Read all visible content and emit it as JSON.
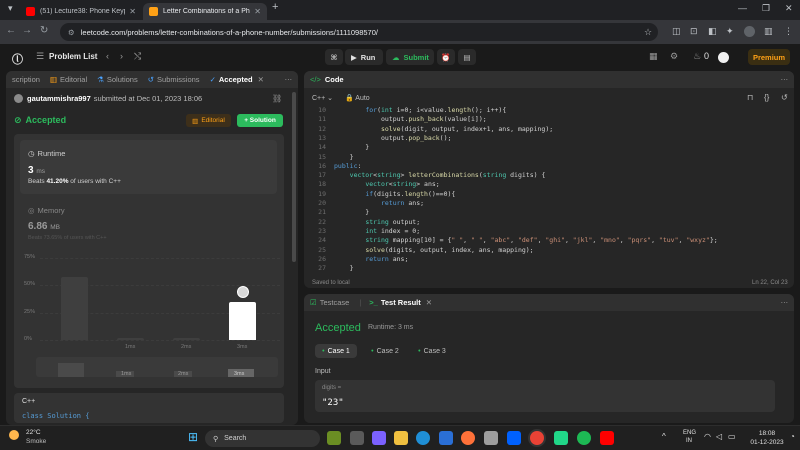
{
  "browser": {
    "tabs": [
      {
        "title": "(51) Lecture38: Phone Keypad P",
        "color": "#ff0000",
        "active": false
      },
      {
        "title": "Letter Combinations of a Phone",
        "color": "#ffa116",
        "active": true
      }
    ],
    "url": "leetcode.com/problems/letter-combinations-of-a-phone-number/submissions/1111098570/"
  },
  "nav": {
    "problem_list": "Problem List",
    "run": "Run",
    "submit": "Submit",
    "streak": "0",
    "premium": "Premium"
  },
  "left": {
    "tabs": [
      "scription",
      "Editorial",
      "Solutions",
      "Submissions",
      "Accepted"
    ],
    "user": "gautammishra997",
    "submitted": "submitted at Dec 01, 2023 18:06",
    "status": "Accepted",
    "editorial_btn": "Editorial",
    "solution_btn": "+ Solution",
    "runtime_label": "Runtime",
    "runtime_value": "3",
    "runtime_unit": "ms",
    "beats_prefix": "Beats",
    "beats_value": "41.20%",
    "beats_suffix": "of users with C++",
    "memory_label": "Memory",
    "memory_value": "6.86",
    "memory_unit": "MB",
    "memory_beats": "Beats 73.65% of users with C++",
    "lang": "C++",
    "code_preview": "class Solution {"
  },
  "chart_data": {
    "type": "bar",
    "ylim": [
      0,
      75
    ],
    "yticks": [
      "75%",
      "50%",
      "25%",
      "0%"
    ],
    "categories": [
      "",
      "1ms",
      "2ms",
      "3ms"
    ],
    "values": [
      58,
      2,
      2,
      35
    ],
    "highlight_index": 3,
    "highlight_color": "#ffffff",
    "base_color": "#3f3f3f"
  },
  "editor": {
    "title": "Code",
    "lang": "C++",
    "mode": "Auto",
    "saved": "Saved to local",
    "cursor": "Ln 22, Col 23",
    "lines": [
      {
        "n": "10",
        "t": "        for(int i=0; i<value.length(); i++){"
      },
      {
        "n": "11",
        "t": "            output.push_back(value[i]);"
      },
      {
        "n": "12",
        "t": "            solve(digit, output, index+1, ans, mapping);"
      },
      {
        "n": "13",
        "t": "            output.pop_back();"
      },
      {
        "n": "14",
        "t": "        }"
      },
      {
        "n": "15",
        "t": "    }"
      },
      {
        "n": "16",
        "t": "public:"
      },
      {
        "n": "17",
        "t": "    vector<string> letterCombinations(string digits) {"
      },
      {
        "n": "18",
        "t": "        vector<string> ans;"
      },
      {
        "n": "19",
        "t": "        if(digits.length()==0){"
      },
      {
        "n": "20",
        "t": "            return ans;"
      },
      {
        "n": "21",
        "t": "        }"
      },
      {
        "n": "22",
        "t": "        string output;"
      },
      {
        "n": "23",
        "t": "        int index = 0;"
      },
      {
        "n": "24",
        "t": "        string mapping[10] = {\" \", \" \", \"abc\", \"def\", \"ghi\", \"jkl\", \"mno\", \"pqrs\", \"tuv\", \"wxyz\"};"
      },
      {
        "n": "25",
        "t": "        solve(digits, output, index, ans, mapping);"
      },
      {
        "n": "26",
        "t": "        return ans;"
      },
      {
        "n": "27",
        "t": "    }"
      }
    ]
  },
  "result": {
    "testcase_tab": "Testcase",
    "result_tab": "Test Result",
    "status": "Accepted",
    "runtime": "Runtime: 3 ms",
    "cases": [
      "Case 1",
      "Case 2",
      "Case 3"
    ],
    "input_label": "Input",
    "var_label": "digits =",
    "var_value": "\"23\""
  },
  "taskbar": {
    "temp": "22°C",
    "weather": "Smoke",
    "search": "Search",
    "lang1": "ENG",
    "lang2": "IN",
    "time": "18:08",
    "date": "01-12-2023"
  }
}
